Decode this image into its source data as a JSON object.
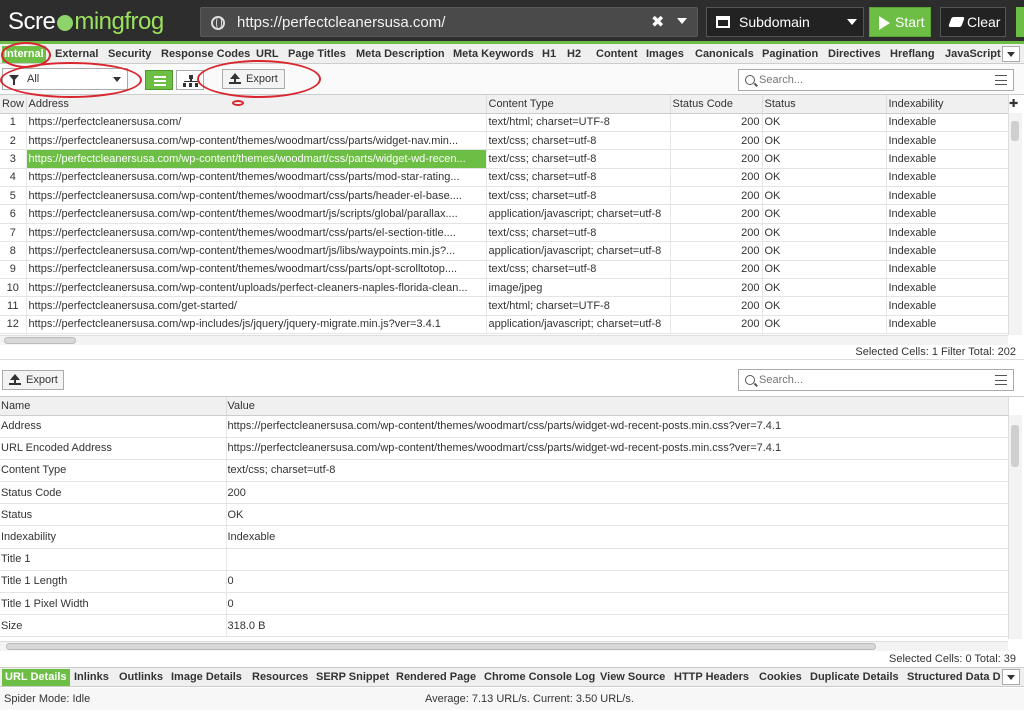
{
  "app": {
    "logo_left": "Scre",
    "logo_right": "mingfrog"
  },
  "crawl": {
    "url": "https://perfectcleanersusa.com/",
    "mode": "Subdomain",
    "start_label": "Start",
    "clear_label": "Clear"
  },
  "tabs": [
    "Internal",
    "External",
    "Security",
    "Response Codes",
    "URL",
    "Page Titles",
    "Meta Description",
    "Meta Keywords",
    "H1",
    "H2",
    "Content",
    "Images",
    "Canonicals",
    "Pagination",
    "Directives",
    "Hreflang",
    "JavaScript"
  ],
  "active_tab": "Internal",
  "toolbar": {
    "filter_value": "All",
    "export_label": "Export",
    "search_placeholder": "Search..."
  },
  "grid": {
    "columns": [
      "Row",
      "Address",
      "Content Type",
      "Status Code",
      "Status",
      "Indexability"
    ],
    "selected_row": 3,
    "rows": [
      [
        "1",
        "https://perfectcleanersusa.com/",
        "text/html; charset=UTF-8",
        "200",
        "OK",
        "Indexable"
      ],
      [
        "2",
        "https://perfectcleanersusa.com/wp-content/themes/woodmart/css/parts/widget-nav.min...",
        "text/css; charset=utf-8",
        "200",
        "OK",
        "Indexable"
      ],
      [
        "3",
        "https://perfectcleanersusa.com/wp-content/themes/woodmart/css/parts/widget-wd-recen...",
        "text/css; charset=utf-8",
        "200",
        "OK",
        "Indexable"
      ],
      [
        "4",
        "https://perfectcleanersusa.com/wp-content/themes/woodmart/css/parts/mod-star-rating...",
        "text/css; charset=utf-8",
        "200",
        "OK",
        "Indexable"
      ],
      [
        "5",
        "https://perfectcleanersusa.com/wp-content/themes/woodmart/css/parts/header-el-base....",
        "text/css; charset=utf-8",
        "200",
        "OK",
        "Indexable"
      ],
      [
        "6",
        "https://perfectcleanersusa.com/wp-content/themes/woodmart/js/scripts/global/parallax....",
        "application/javascript; charset=utf-8",
        "200",
        "OK",
        "Indexable"
      ],
      [
        "7",
        "https://perfectcleanersusa.com/wp-content/themes/woodmart/css/parts/el-section-title....",
        "text/css; charset=utf-8",
        "200",
        "OK",
        "Indexable"
      ],
      [
        "8",
        "https://perfectcleanersusa.com/wp-content/themes/woodmart/js/libs/waypoints.min.js?...",
        "application/javascript; charset=utf-8",
        "200",
        "OK",
        "Indexable"
      ],
      [
        "9",
        "https://perfectcleanersusa.com/wp-content/themes/woodmart/css/parts/opt-scrolltotop....",
        "text/css; charset=utf-8",
        "200",
        "OK",
        "Indexable"
      ],
      [
        "10",
        "https://perfectcleanersusa.com/wp-content/uploads/perfect-cleaners-naples-florida-clean...",
        "image/jpeg",
        "200",
        "OK",
        "Indexable"
      ],
      [
        "11",
        "https://perfectcleanersusa.com/get-started/",
        "text/html; charset=UTF-8",
        "200",
        "OK",
        "Indexable"
      ],
      [
        "12",
        "https://perfectcleanersusa.com/wp-includes/js/jquery/jquery-migrate.min.js?ver=3.4.1",
        "application/javascript; charset=utf-8",
        "200",
        "OK",
        "Indexable"
      ]
    ]
  },
  "status_top": "Selected Cells: 1  Filter Total: 202",
  "detail": {
    "export_label": "Export",
    "search_placeholder": "Search...",
    "columns": [
      "Name",
      "Value"
    ],
    "rows": [
      [
        "Address",
        "https://perfectcleanersusa.com/wp-content/themes/woodmart/css/parts/widget-wd-recent-posts.min.css?ver=7.4.1"
      ],
      [
        "URL Encoded Address",
        "https://perfectcleanersusa.com/wp-content/themes/woodmart/css/parts/widget-wd-recent-posts.min.css?ver=7.4.1"
      ],
      [
        "Content Type",
        "text/css; charset=utf-8"
      ],
      [
        "Status Code",
        "200"
      ],
      [
        "Status",
        "OK"
      ],
      [
        "Indexability",
        "Indexable"
      ],
      [
        "Title 1",
        ""
      ],
      [
        "Title 1 Length",
        "0"
      ],
      [
        "Title 1 Pixel Width",
        "0"
      ],
      [
        "Size",
        "318.0 B"
      ]
    ]
  },
  "status_bottom": "Selected Cells: 0  Total: 39",
  "bottom_tabs": [
    "URL Details",
    "Inlinks",
    "Outlinks",
    "Image Details",
    "Resources",
    "SERP Snippet",
    "Rendered Page",
    "Chrome Console Log",
    "View Source",
    "HTTP Headers",
    "Cookies",
    "Duplicate Details",
    "Structured Data D"
  ],
  "active_bottom_tab": "URL Details",
  "footer": {
    "spider_mode": "Spider Mode: Idle",
    "rate": "Average: 7.13 URL/s. Current: 3.50 URL/s."
  },
  "icons": [
    "globe-icon",
    "close-icon",
    "chevron-down-icon",
    "subdomain-icon",
    "play-icon",
    "eraser-icon",
    "filter-icon",
    "list-view-icon",
    "tree-view-icon",
    "export-icon",
    "search-icon",
    "sliders-icon"
  ],
  "colors": {
    "accent": "#6dbe45",
    "topbar": "#2d2d2d",
    "annotation": "#d9262e"
  }
}
